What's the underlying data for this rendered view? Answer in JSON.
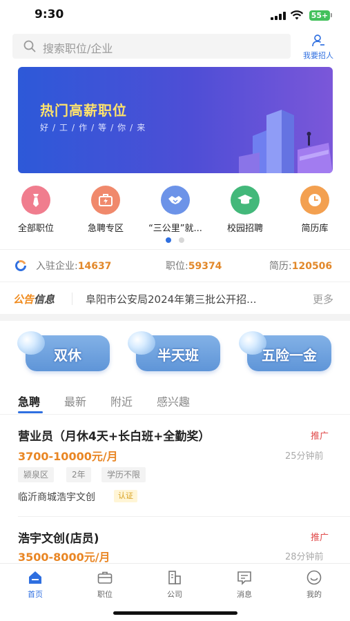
{
  "status": {
    "time": "9:30",
    "battery": "55+"
  },
  "search": {
    "placeholder": "搜索职位/企业"
  },
  "header": {
    "recruit_label": "我要招人"
  },
  "banner": {
    "title": "热门高薪职位",
    "subtitle": "好/工/作/等/你/来"
  },
  "categories": [
    {
      "label": "全部职位",
      "color": "#f07d8e",
      "icon": "tie-icon"
    },
    {
      "label": "急聘专区",
      "color": "#f0896c",
      "icon": "urgent-briefcase-icon"
    },
    {
      "label": "“三公里”就...",
      "color": "#6c93e8",
      "icon": "handshake-icon"
    },
    {
      "label": "校园招聘",
      "color": "#43b87a",
      "icon": "graduation-cap-icon"
    },
    {
      "label": "简历库",
      "color": "#f3a050",
      "icon": "clock-icon"
    }
  ],
  "carousel": {
    "page": 1,
    "pages": 2
  },
  "stats": {
    "companies_label": "入驻企业:",
    "companies_value": "14637",
    "jobs_label": "职位:",
    "jobs_value": "59374",
    "resumes_label": "简历:",
    "resumes_value": "120506"
  },
  "notice": {
    "tag_a": "公告",
    "tag_b": "信息",
    "text": "阜阳市公安局2024年第三批公开招...",
    "more": "更多"
  },
  "features": [
    {
      "label": "双休"
    },
    {
      "label": "半天班"
    },
    {
      "label": "五险一金"
    }
  ],
  "tabs": [
    {
      "label": "急聘",
      "active": true
    },
    {
      "label": "最新",
      "active": false
    },
    {
      "label": "附近",
      "active": false
    },
    {
      "label": "感兴趣",
      "active": false
    }
  ],
  "jobs": [
    {
      "title": "营业员（月休4天+长白班+全勤奖）",
      "promo": "推广",
      "salary": "3700-10000元/月",
      "time": "25分钟前",
      "tags": [
        "颍泉区",
        "2年",
        "学历不限"
      ],
      "company": "临沂商城浩宇文创",
      "verified": "认证"
    },
    {
      "title": "浩宇文创(店员)",
      "promo": "推广",
      "salary": "3500-8000元/月",
      "time": "28分钟前"
    }
  ],
  "nav": [
    {
      "label": "首页",
      "icon": "home-icon",
      "active": true
    },
    {
      "label": "职位",
      "icon": "briefcase-icon",
      "active": false
    },
    {
      "label": "公司",
      "icon": "building-icon",
      "active": false
    },
    {
      "label": "消息",
      "icon": "message-icon",
      "active": false
    },
    {
      "label": "我的",
      "icon": "profile-icon",
      "active": false
    }
  ],
  "colors": {
    "accent": "#2f6fe0",
    "salary": "#e98624",
    "promo": "#e04b4b"
  }
}
